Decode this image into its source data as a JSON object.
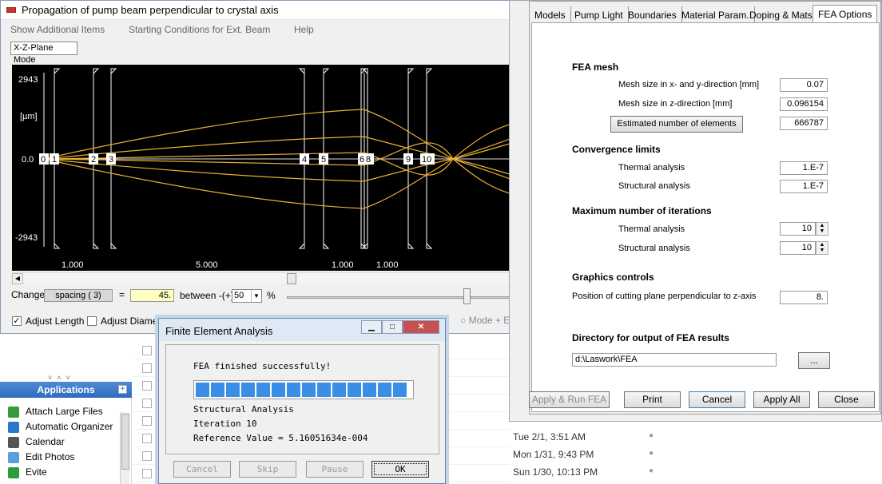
{
  "background": {
    "applications_header": "Applications",
    "applications": [
      {
        "label": "Attach Large Files",
        "icon": "attach-icon",
        "color": "#3a9a3a"
      },
      {
        "label": "Automatic Organizer",
        "icon": "organizer-icon",
        "color": "#2a78c8"
      },
      {
        "label": "Calendar",
        "icon": "calendar-icon",
        "color": "#555555"
      },
      {
        "label": "Edit Photos",
        "icon": "photos-icon",
        "color": "#5aa0d8"
      },
      {
        "label": "Evite",
        "icon": "evite-icon",
        "color": "#2e9a3e"
      }
    ],
    "mail_dates": [
      "Tue 2/1, 3:51 AM",
      "Mon 1/31, 9:43 PM",
      "Sun 1/30, 10:13 PM"
    ]
  },
  "propagation": {
    "title": "Propagation of pump beam perpendicular to crystal axis",
    "menu": [
      "Show Additional Items",
      "Starting Conditions for Ext. Beam",
      "Help"
    ],
    "mode": "X-Z-Plane Mode",
    "axis_top": "2943",
    "axis_unit": "[µm]",
    "axis_zero": "0.0",
    "axis_bottom": "-2943",
    "elements": [
      "0",
      "1",
      "2",
      "3",
      "4",
      "5",
      "6",
      "8",
      "9",
      "10"
    ],
    "spacings": [
      "1.000",
      "5.000",
      "1.000",
      "1.000"
    ],
    "change_label": "Change",
    "spacing_field": "spacing  ( 3)",
    "equals": "=",
    "value": "45.",
    "between_label": "between  -(+)",
    "percent_value": "50",
    "percent_sign": "%",
    "adjust_length": "Adjust Length",
    "adjust_diameter": "Adjust Diameter",
    "mode_e": "Mode + E"
  },
  "fea": {
    "tabs": [
      "Models",
      "Pump Light",
      "Boundaries",
      "Material Param.",
      "Doping & Mats.",
      "FEA Options"
    ],
    "active_tab": "FEA Options",
    "mesh_title": "FEA mesh",
    "mesh_xy_label": "Mesh size in x- and y-direction [mm]",
    "mesh_xy": "0.07",
    "mesh_z_label": "Mesh size in z-direction [mm]",
    "mesh_z": "0.096154",
    "est_button": "Estimated number of elements",
    "est_value": "666787",
    "conv_title": "Convergence limits",
    "conv_thermal_label": "Thermal analysis",
    "conv_thermal": "1.E-7",
    "conv_struct_label": "Structural analysis",
    "conv_struct": "1.E-7",
    "iter_title": "Maximum number of iterations",
    "iter_thermal_label": "Thermal analysis",
    "iter_thermal": "10",
    "iter_struct_label": "Structural analysis",
    "iter_struct": "10",
    "graphics_title": "Graphics controls",
    "cut_label": "Position of cutting plane perpendicular to z-axis",
    "cut_value": "8.",
    "dir_title": "Directory for output of FEA results",
    "dir_value": "d:\\Laswork\\FEA",
    "browse": "...",
    "buttons": [
      "Apply  &  Run FEA",
      "Print",
      "Cancel",
      "Apply All",
      "Close"
    ]
  },
  "dialog": {
    "title": "Finite Element Analysis",
    "message": "FEA finished successfully!",
    "progress": 1.0,
    "line1": "Structural Analysis",
    "line2": "Iteration 10",
    "line3": "Reference Value = 5.16051634e-004",
    "buttons": [
      "Cancel",
      "Skip",
      "Pause",
      "OK"
    ]
  },
  "colors": {
    "beam": "#e8b030",
    "progress": "#3b8ee6",
    "value_box": "#ffffc0"
  }
}
